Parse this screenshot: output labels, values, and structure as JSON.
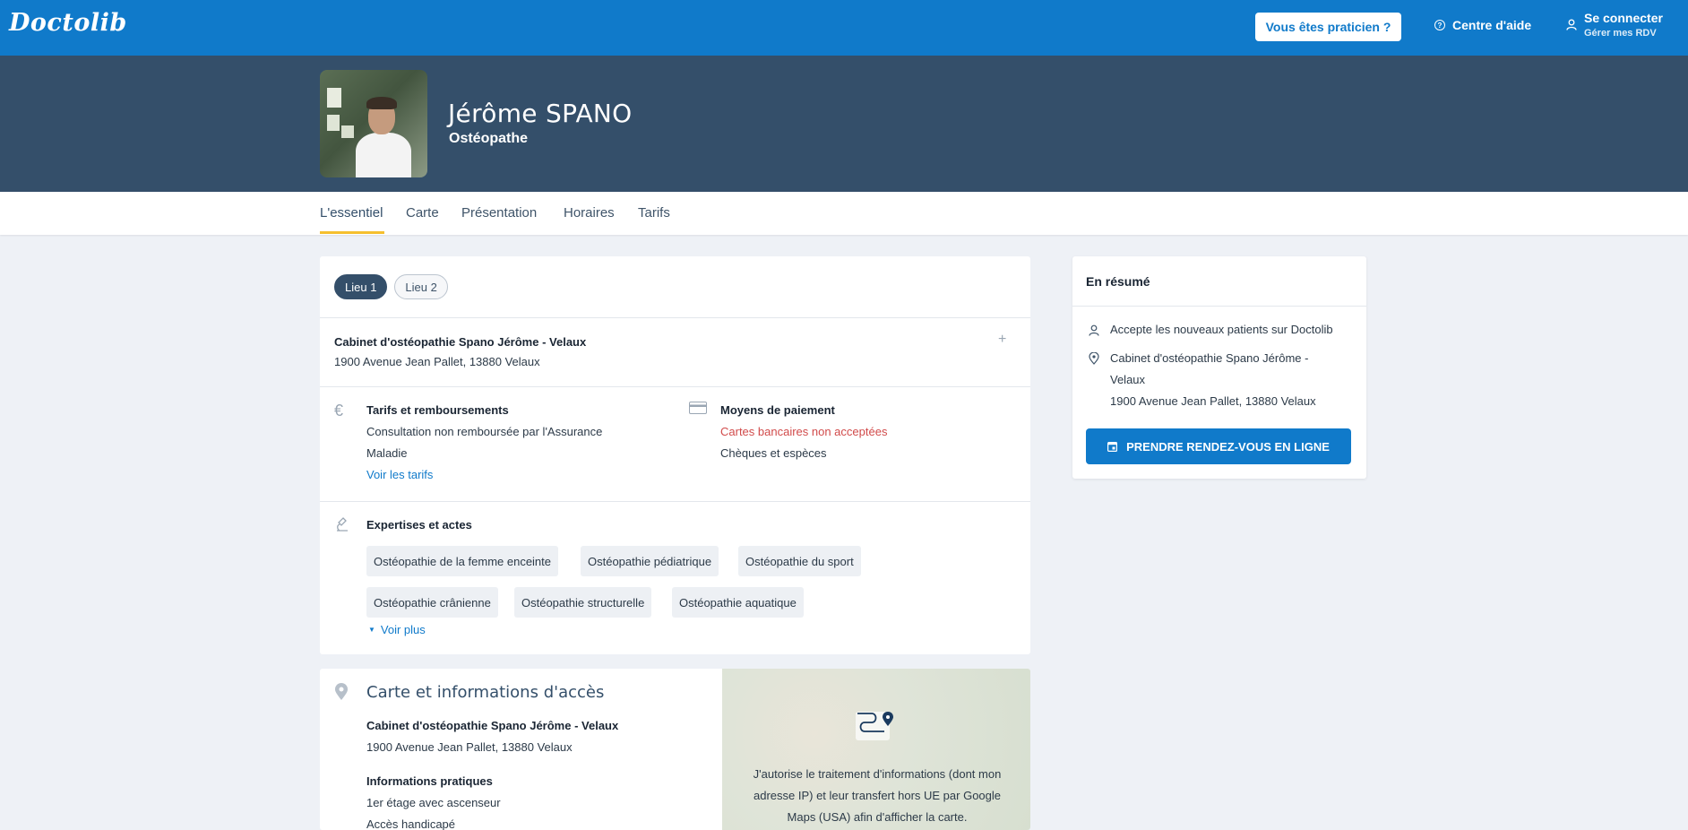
{
  "brand": {
    "logo": "Doctolib",
    "primary_color": "#107aca",
    "header_bg": "#344f6a",
    "accent": "#f5bf2e"
  },
  "topbar": {
    "pro_button": "Vous êtes praticien ?",
    "help": "Centre d'aide",
    "login_title": "Se connecter",
    "login_sub": "Gérer mes RDV"
  },
  "profile": {
    "name": "Jérôme SPANO",
    "specialty": "Ostéopathe"
  },
  "tabs": [
    "L'essentiel",
    "Carte",
    "Présentation",
    "Horaires",
    "Tarifs"
  ],
  "main": {
    "locations": [
      "Lieu 1",
      "Lieu 2"
    ],
    "cabinet_name": "Cabinet d'ostéopathie Spano Jérôme - Velaux",
    "cabinet_address": "1900 Avenue Jean Pallet, 13880 Velaux",
    "tarifs": {
      "title": "Tarifs et remboursements",
      "line1": "Consultation non remboursée par l'Assurance",
      "line2": "Maladie",
      "link": "Voir les tarifs"
    },
    "payment": {
      "title": "Moyens de paiement",
      "cards": "Cartes bancaires non acceptées",
      "other": "Chèques et espèces"
    },
    "expertises": {
      "title": "Expertises et actes",
      "tags": [
        "Ostéopathie de la femme enceinte",
        "Ostéopathie pédiatrique",
        "Ostéopathie du sport",
        "Ostéopathie crânienne",
        "Ostéopathie structurelle",
        "Ostéopathie aquatique"
      ],
      "more": "Voir plus"
    }
  },
  "map_section": {
    "title": "Carte et informations d'accès",
    "cabinet_name": "Cabinet d'ostéopathie Spano Jérôme - Velaux",
    "cabinet_address": "1900 Avenue Jean Pallet, 13880 Velaux",
    "practical_title": "Informations pratiques",
    "practical_1": "1er étage avec ascenseur",
    "practical_2": "Accès handicapé",
    "consent_text": "J'autorise le traitement d'informations (dont mon adresse IP) et leur transfert hors UE par Google Maps (USA) afin d'afficher la carte."
  },
  "summary": {
    "title": "En résumé",
    "new_patients": "Accepte les nouveaux patients sur Doctolib",
    "address_line1": "Cabinet d'ostéopathie Spano Jérôme -",
    "address_line2": "Velaux",
    "address_line3": "1900 Avenue Jean Pallet, 13880 Velaux",
    "cta": "PRENDRE RENDEZ-VOUS EN LIGNE"
  }
}
